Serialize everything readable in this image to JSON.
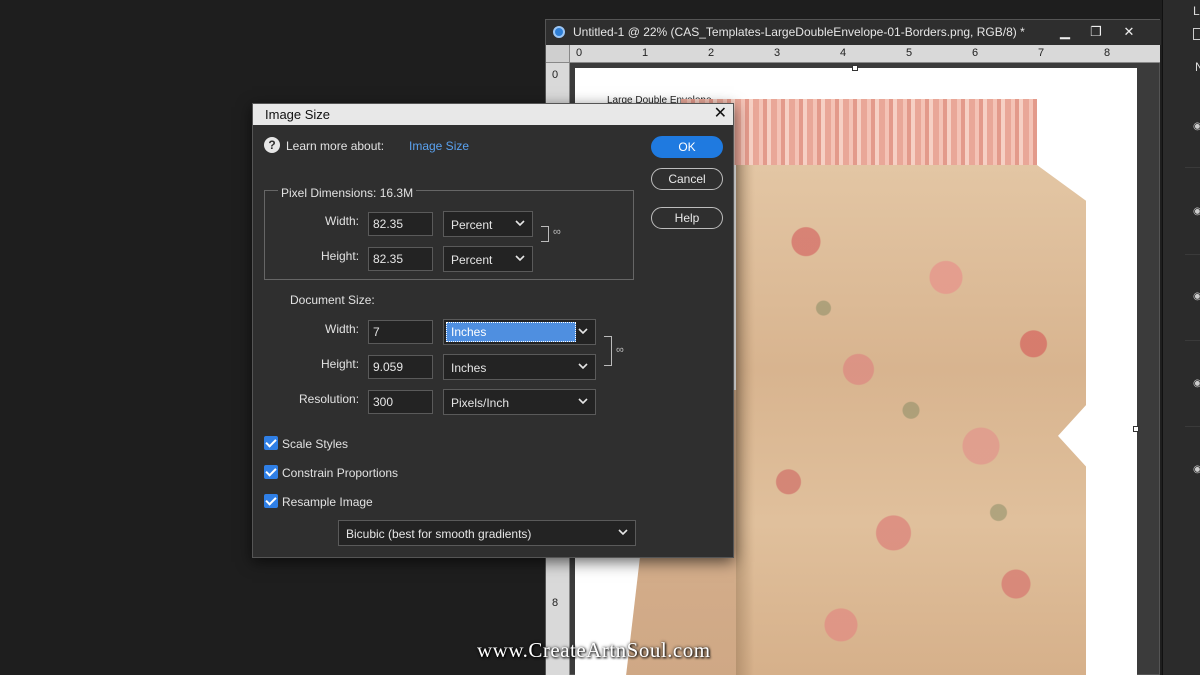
{
  "document": {
    "title": "Untitled-1 @ 22% (CAS_Templates-LargeDoubleEnvelope-01-Borders.png, RGB/8) *",
    "window_buttons": [
      "▁",
      "❐",
      "✕"
    ],
    "ruler_top": [
      "0",
      "1",
      "2",
      "3",
      "4",
      "5",
      "6",
      "7",
      "8"
    ],
    "ruler_left": [
      "0",
      "8"
    ],
    "canvas_label": "Large Double Envelope"
  },
  "right_panel": {
    "top_label": "L",
    "n_label": "N"
  },
  "dialog": {
    "title": "Image Size",
    "close": "✕",
    "learn_more_label": "Learn more about:",
    "learn_more_link": "Image Size",
    "buttons": {
      "ok": "OK",
      "cancel": "Cancel",
      "help": "Help"
    },
    "pixel_dimensions": {
      "label": "Pixel Dimensions:",
      "size": "16.3M",
      "width_label": "Width:",
      "width_value": "82.35",
      "width_unit": "Percent",
      "height_label": "Height:",
      "height_value": "82.35",
      "height_unit": "Percent"
    },
    "document_size": {
      "label": "Document Size:",
      "width_label": "Width:",
      "width_value": "7",
      "width_unit": "Inches",
      "height_label": "Height:",
      "height_value": "9.059",
      "height_unit": "Inches",
      "resolution_label": "Resolution:",
      "resolution_value": "300",
      "resolution_unit": "Pixels/Inch"
    },
    "options": {
      "scale_styles": "Scale Styles",
      "constrain_proportions": "Constrain Proportions",
      "resample_image": "Resample Image",
      "resample_method": "Bicubic (best for smooth gradients)"
    }
  },
  "watermark": "www.CreateArtnSoul.com",
  "colors": {
    "accent": "#1f7ae0",
    "link": "#5aa2f0",
    "dialog_bg": "#2f2f2f"
  }
}
